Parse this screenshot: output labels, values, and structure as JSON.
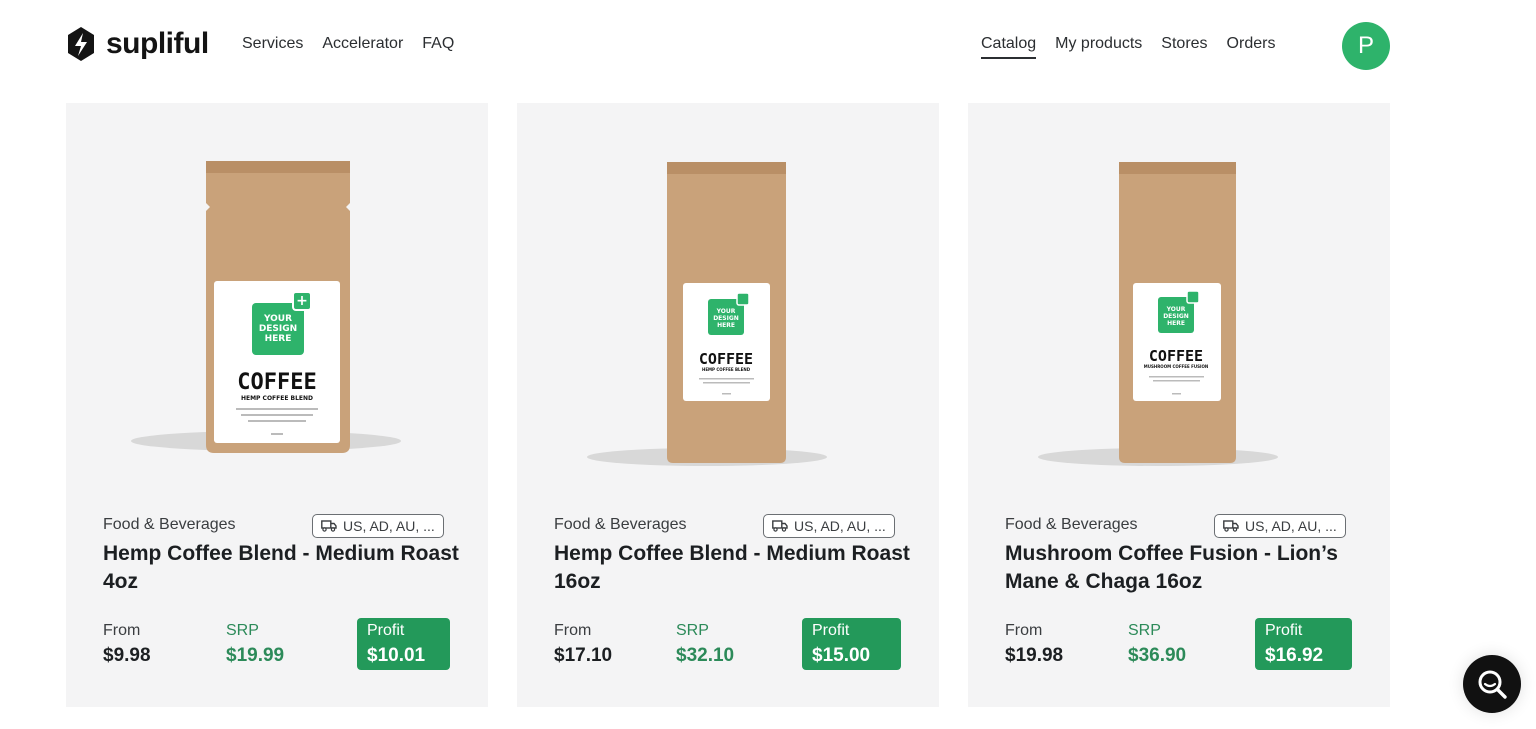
{
  "brand": {
    "name": "supliful"
  },
  "nav": {
    "left": [
      "Services",
      "Accelerator",
      "FAQ"
    ],
    "right": [
      {
        "label": "Catalog",
        "active": true
      },
      {
        "label": "My products",
        "active": false
      },
      {
        "label": "Stores",
        "active": false
      },
      {
        "label": "Orders",
        "active": false
      }
    ],
    "avatar_initial": "P"
  },
  "colors": {
    "brand_green": "#23995a",
    "avatar_green": "#2eb36b",
    "srp_green": "#2c8a59",
    "card_bg": "#f4f4f5"
  },
  "products": [
    {
      "category": "Food & Beverages",
      "shipping": "US, AD, AU, ...",
      "title": "Hemp Coffee Blend - Medium Roast 4oz",
      "from_label": "From",
      "from_price": "$9.98",
      "srp_label": "SRP",
      "srp_price": "$19.99",
      "profit_label": "Profit",
      "profit_value": "$10.01",
      "image": {
        "label_title": "COFFEE",
        "label_sub": "HEMP COFFEE BLEND",
        "design_text": [
          "YOUR",
          "DESIGN",
          "HERE"
        ],
        "weight": "4oz"
      }
    },
    {
      "category": "Food & Beverages",
      "shipping": "US, AD, AU, ...",
      "title": "Hemp Coffee Blend - Medium Roast 16oz",
      "from_label": "From",
      "from_price": "$17.10",
      "srp_label": "SRP",
      "srp_price": "$32.10",
      "profit_label": "Profit",
      "profit_value": "$15.00",
      "image": {
        "label_title": "COFFEE",
        "label_sub": "HEMP COFFEE BLEND",
        "design_text": [
          "YOUR",
          "DESIGN",
          "HERE"
        ]
      }
    },
    {
      "category": "Food & Beverages",
      "shipping": "US, AD, AU, ...",
      "title": "Mushroom Coffee Fusion - Lion’s Mane & Chaga 16oz",
      "from_label": "From",
      "from_price": "$19.98",
      "srp_label": "SRP",
      "srp_price": "$36.90",
      "profit_label": "Profit",
      "profit_value": "$16.92",
      "image": {
        "label_title": "COFFEE",
        "label_sub": "MUSHROOM COFFEE FUSION",
        "design_text": [
          "YOUR",
          "DESIGN",
          "HERE"
        ]
      }
    }
  ],
  "icons": {
    "shipping": "truck-icon",
    "chat": "search-chat-icon",
    "logo": "bolt-logo-icon"
  }
}
